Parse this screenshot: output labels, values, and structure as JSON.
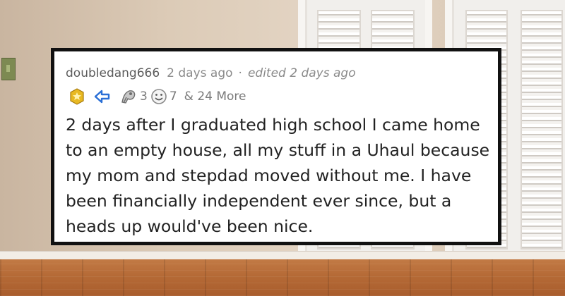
{
  "comment": {
    "username": "doubledang666",
    "time_ago": "2 days ago",
    "separator": "·",
    "edited_label": "edited 2 days ago",
    "awards": [
      {
        "icon": "gold-award-icon",
        "count": ""
      },
      {
        "icon": "blue-arrow-award-icon",
        "count": ""
      },
      {
        "icon": "silver-award-icon",
        "count": "3"
      },
      {
        "icon": "grinning-face-award-icon",
        "count": "7"
      }
    ],
    "more_awards_label": "& 24 More",
    "body": "2 days after I graduated high school I came home to an empty house, all my stuff in a Uhaul because my mom and stepdad moved without me. I have been financially independent ever since, but a heads up would've been nice."
  },
  "colors": {
    "card_border": "#111111",
    "card_background": "#ffffff",
    "meta_text": "#8a8a8a",
    "body_text": "#222222",
    "award_gold": "#e8b923",
    "award_blue": "#2a6fd6"
  }
}
